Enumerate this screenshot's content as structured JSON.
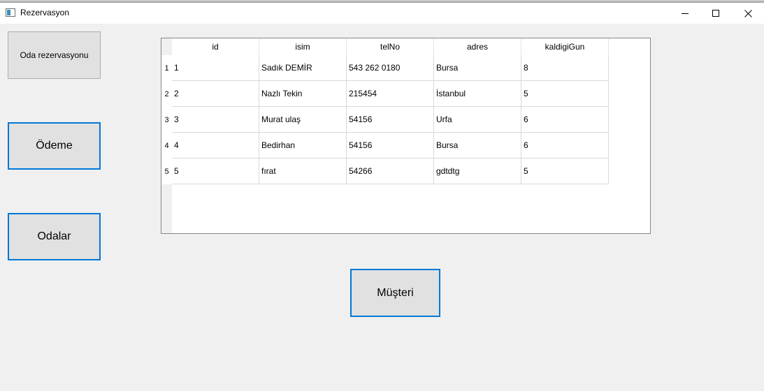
{
  "window": {
    "title": "Rezervasyon",
    "icon": "app-window-icon",
    "controls": [
      "minimize-icon",
      "maximize-icon",
      "close-icon"
    ]
  },
  "buttons": {
    "oda_rezervasyonu": "Oda rezervasyonu",
    "odeme": "Ödeme",
    "odalar": "Odalar",
    "musteri": "Müşteri"
  },
  "table": {
    "columns": [
      "id",
      "isim",
      "telNo",
      "adres",
      "kaldigiGun"
    ],
    "row_numbers": [
      "1",
      "2",
      "3",
      "4",
      "5"
    ],
    "rows": [
      [
        "1",
        "Sadık DEMİR",
        "543 262 0180",
        "Bursa",
        "8"
      ],
      [
        "2",
        "Nazlı Tekin",
        "215454",
        "İstanbul",
        "5"
      ],
      [
        "3",
        "Murat ulaş",
        "54156",
        "Urfa",
        "6"
      ],
      [
        "4",
        "Bedirhan",
        "54156",
        "Bursa",
        "6"
      ],
      [
        "5",
        "fırat",
        "54266",
        "gdtdtg",
        "5"
      ]
    ]
  },
  "colors": {
    "focus_border": "#0078d7",
    "button_face": "#e1e1e1",
    "window_bg": "#f0f0f0"
  }
}
